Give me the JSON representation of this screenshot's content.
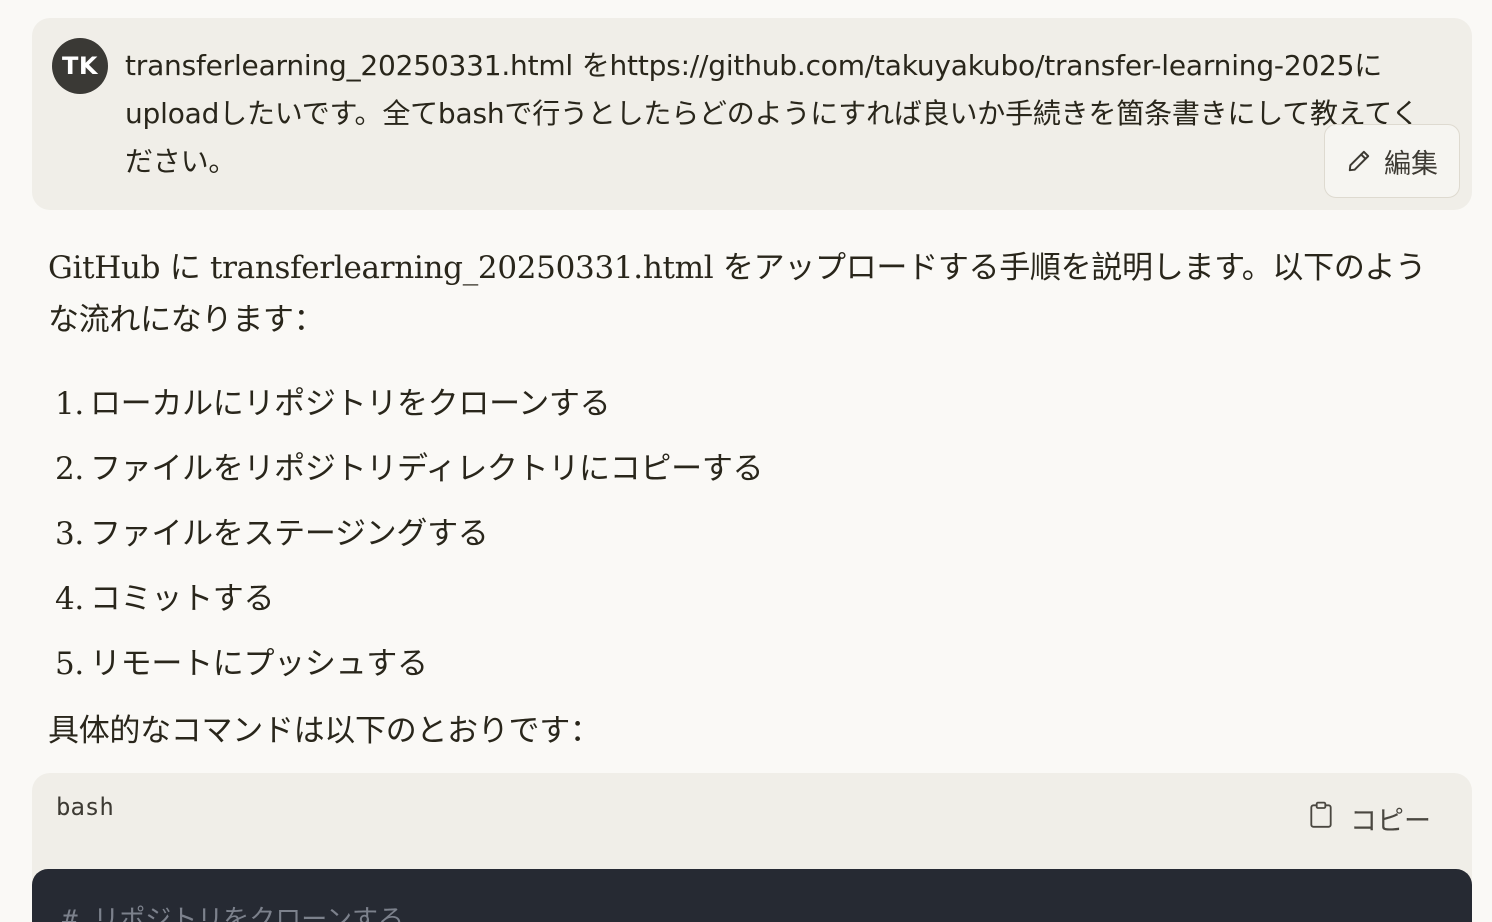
{
  "user_message": {
    "avatar_initials": "TK",
    "text": "transferlearning_20250331.html をhttps://github.com/takuyakubo/transfer-learning-2025にuploadしたいです。全てbashで行うとしたらどのようにすれば良いか手続きを箇条書きにして教えてください。",
    "edit_label": "編集",
    "edit_icon": "pencil-icon"
  },
  "assistant_message": {
    "intro": "GitHub に transferlearning_20250331.html をアップロードする手順を説明します。以下のような流れになります：",
    "steps": [
      {
        "num": "1.",
        "text": "ローカルにリポジトリをクローンする"
      },
      {
        "num": "2.",
        "text": "ファイルをリポジトリディレクトリにコピーする"
      },
      {
        "num": "3.",
        "text": "ファイルをステージングする"
      },
      {
        "num": "4.",
        "text": "コミットする"
      },
      {
        "num": "5.",
        "text": "リモートにプッシュする"
      }
    ],
    "commands_intro": "具体的なコマンドは以下のとおりです："
  },
  "code_block": {
    "language": "bash",
    "copy_label": "コピー",
    "copy_icon": "clipboard-icon",
    "first_line": "# リポジトリをクローンする"
  },
  "colors": {
    "page_bg": "#faf9f6",
    "bubble_bg": "#f0eee8",
    "avatar_bg": "#3a3935",
    "code_bg": "#262a33",
    "text": "#29261b"
  }
}
